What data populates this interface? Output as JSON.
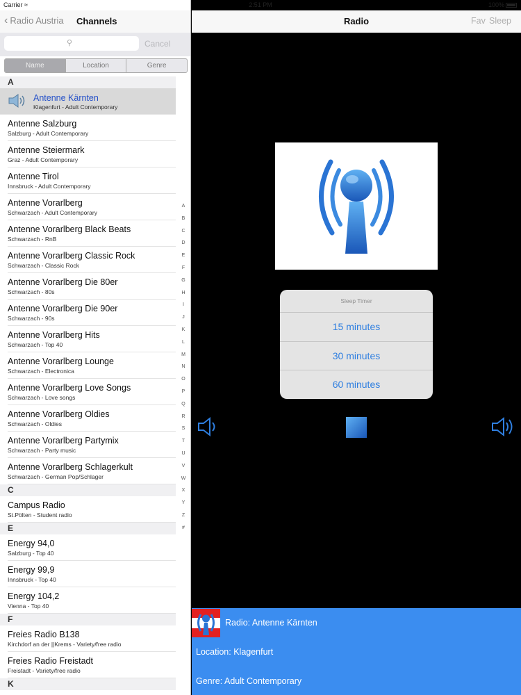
{
  "status": {
    "carrier": "Carrier",
    "time": "2:51 PM",
    "battery": "100%"
  },
  "master": {
    "back_label": "Radio Austria",
    "title": "Channels",
    "search": {
      "cancel": "Cancel"
    },
    "segments": [
      "Name",
      "Location",
      "Genre"
    ],
    "index_letters": [
      "A",
      "B",
      "C",
      "D",
      "E",
      "F",
      "G",
      "H",
      "I",
      "J",
      "K",
      "L",
      "M",
      "N",
      "O",
      "P",
      "Q",
      "R",
      "S",
      "T",
      "U",
      "V",
      "W",
      "X",
      "Y",
      "Z",
      "#"
    ],
    "sections": [
      {
        "letter": "A",
        "rows": [
          {
            "name": "Antenne Kärnten",
            "sub": "Klagenfurt - Adult Contemporary",
            "selected": true
          },
          {
            "name": "Antenne Salzburg",
            "sub": "Salzburg - Adult Contemporary"
          },
          {
            "name": "Antenne Steiermark",
            "sub": "Graz - Adult Contemporary"
          },
          {
            "name": "Antenne Tirol",
            "sub": "Innsbruck - Adult Contemporary"
          },
          {
            "name": "Antenne Vorarlberg",
            "sub": "Schwarzach - Adult Contemporary"
          },
          {
            "name": "Antenne Vorarlberg Black Beats",
            "sub": "Schwarzach - RnB"
          },
          {
            "name": "Antenne Vorarlberg Classic Rock",
            "sub": "Schwarzach - Classic Rock"
          },
          {
            "name": "Antenne Vorarlberg Die 80er",
            "sub": "Schwarzach - 80s"
          },
          {
            "name": "Antenne Vorarlberg Die 90er",
            "sub": "Schwarzach - 90s"
          },
          {
            "name": "Antenne Vorarlberg Hits",
            "sub": "Schwarzach - Top 40"
          },
          {
            "name": "Antenne Vorarlberg Lounge",
            "sub": "Schwarzach - Electronica"
          },
          {
            "name": "Antenne Vorarlberg Love Songs",
            "sub": "Schwarzach - Love songs"
          },
          {
            "name": "Antenne Vorarlberg Oldies",
            "sub": "Schwarzach - Oldies"
          },
          {
            "name": "Antenne Vorarlberg Partymix",
            "sub": "Schwarzach - Party music"
          },
          {
            "name": "Antenne Vorarlberg Schlagerkult",
            "sub": "Schwarzach - German Pop/Schlager"
          }
        ]
      },
      {
        "letter": "C",
        "rows": [
          {
            "name": "Campus Radio",
            "sub": "St.Pölten - Student radio"
          }
        ]
      },
      {
        "letter": "E",
        "rows": [
          {
            "name": "Energy 94,0",
            "sub": "Salzburg - Top 40"
          },
          {
            "name": "Energy 99,9",
            "sub": "Innsbruck - Top 40"
          },
          {
            "name": "Energy 104,2",
            "sub": "Vienna - Top 40"
          }
        ]
      },
      {
        "letter": "F",
        "rows": [
          {
            "name": "Freies Radio B138",
            "sub": "Kirchdorf an der ||Krems - Variety/free radio"
          },
          {
            "name": "Freies Radio Freistadt",
            "sub": "Freistadt - Variety/free radio"
          }
        ]
      },
      {
        "letter": "K",
        "rows": []
      }
    ]
  },
  "detail": {
    "title": "Radio",
    "fav_label": "Fav",
    "sleep_label": "Sleep",
    "sleep_timer": {
      "title": "Sleep Timer",
      "options": [
        "15 minutes",
        "30 minutes",
        "60 minutes"
      ]
    },
    "now_playing": {
      "radio_line": "Radio: Antenne Kärnten",
      "location_line": "Location: Klagenfurt",
      "genre_line": "Genre: Adult Contemporary"
    }
  },
  "icons": {
    "back": "chevron-left-icon",
    "search": "magnifier-icon",
    "speaker": "speaker-icon",
    "volume_down": "volume-down-icon",
    "stop": "stop-icon",
    "volume_up": "volume-up-icon"
  },
  "colors": {
    "accent": "#2f7fe0",
    "info_bar": "#3b8df0",
    "selected_text": "#2450c8",
    "player_background": "#000000"
  }
}
